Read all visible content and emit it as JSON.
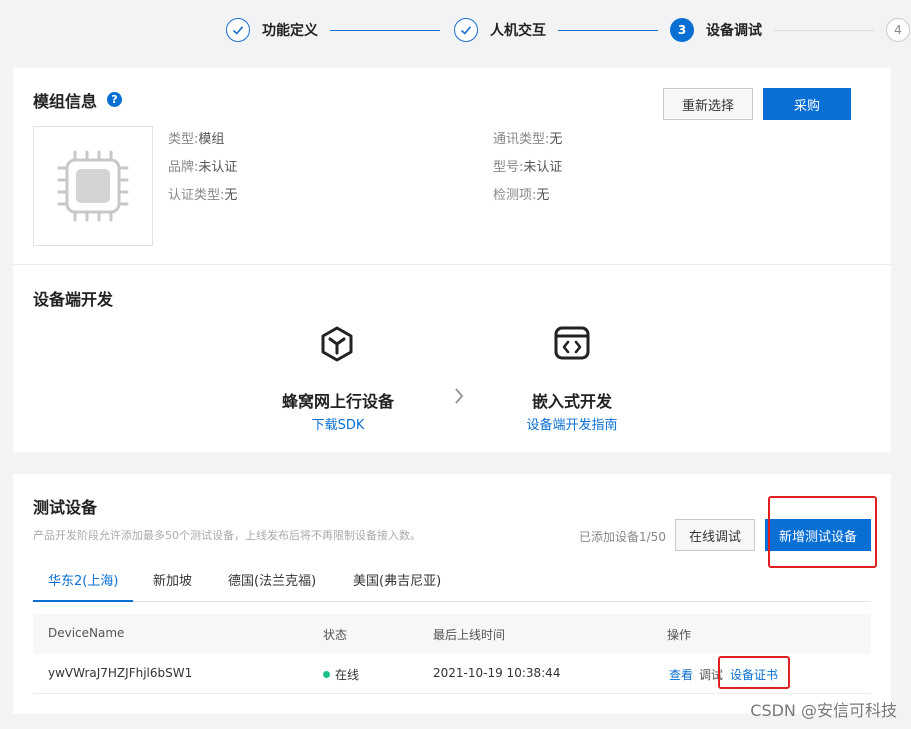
{
  "stepper": {
    "steps": [
      {
        "label": "功能定义",
        "state": "done",
        "number": ""
      },
      {
        "label": "人机交互",
        "state": "done",
        "number": ""
      },
      {
        "label": "设备调试",
        "state": "active",
        "number": "3"
      },
      {
        "label": "",
        "state": "todo",
        "number": "4"
      }
    ]
  },
  "module_info": {
    "title": "模组信息",
    "help_icon": "?",
    "reselect_button": "重新选择",
    "purchase_button": "采购",
    "chip_icon": "chip-icon",
    "fields_left": [
      {
        "key": "类型:",
        "value": "模组"
      },
      {
        "key": "品牌:",
        "value": "未认证"
      },
      {
        "key": "认证类型:",
        "value": "无"
      }
    ],
    "fields_right": [
      {
        "key": "通讯类型:",
        "value": "无"
      },
      {
        "key": "型号:",
        "value": "未认证"
      },
      {
        "key": "检测项:",
        "value": "无"
      }
    ]
  },
  "device_dev": {
    "title": "设备端开发",
    "options": [
      {
        "icon": "cube-icon",
        "title": "蜂窝网上行设备",
        "link": "下载SDK"
      },
      {
        "icon": "code-window-icon",
        "title": "嵌入式开发",
        "link": "设备端开发指南"
      }
    ]
  },
  "test_devices": {
    "title": "测试设备",
    "description": "产品开发阶段允许添加最多50个测试设备，上线发布后将不再限制设备接入数。",
    "added_count": "已添加设备1/50",
    "online_debug_button": "在线调试",
    "add_device_button": "新增测试设备",
    "tabs": [
      "华东2(上海)",
      "新加坡",
      "德国(法兰克福)",
      "美国(弗吉尼亚)"
    ],
    "active_tab": 0,
    "columns": [
      "DeviceName",
      "状态",
      "最后上线时间",
      "操作"
    ],
    "rows": [
      {
        "device_name": "ywVWraJ7HZJFhjl6bSW1",
        "status": "在线",
        "last_online": "2021-10-19 10:38:44",
        "actions": [
          "查看",
          "调试",
          "设备证书"
        ]
      }
    ]
  },
  "watermark": "CSDN @安信可科技",
  "colors": {
    "accent": "#0a6fd3",
    "highlight": "#e02020",
    "online": "#1ac18a"
  }
}
